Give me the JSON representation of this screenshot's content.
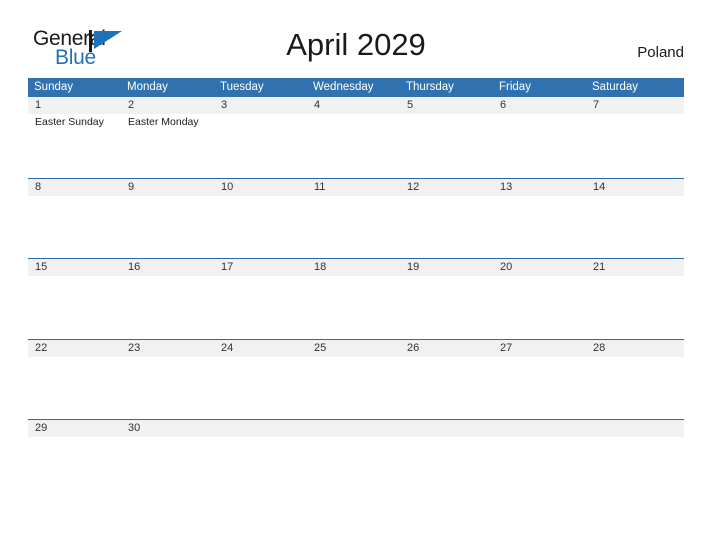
{
  "brand": {
    "word_one": "General",
    "word_two": "Blue",
    "mark_icon": "triangle-flag-icon",
    "accent_color": "#2272b8"
  },
  "header": {
    "title": "April 2029",
    "country": "Poland"
  },
  "theme": {
    "header_blue": "#3071b0",
    "row_divider_blue": "#2e6da4",
    "date_band_gray": "#f1f1f1",
    "text_dark": "#1a1a1a"
  },
  "calendar": {
    "weekdays": [
      "Sunday",
      "Monday",
      "Tuesday",
      "Wednesday",
      "Thursday",
      "Friday",
      "Saturday"
    ],
    "weeks": [
      {
        "days": [
          {
            "date": "1",
            "events": [
              "Easter Sunday"
            ]
          },
          {
            "date": "2",
            "events": [
              "Easter Monday"
            ]
          },
          {
            "date": "3",
            "events": []
          },
          {
            "date": "4",
            "events": []
          },
          {
            "date": "5",
            "events": []
          },
          {
            "date": "6",
            "events": []
          },
          {
            "date": "7",
            "events": []
          }
        ]
      },
      {
        "days": [
          {
            "date": "8",
            "events": []
          },
          {
            "date": "9",
            "events": []
          },
          {
            "date": "10",
            "events": []
          },
          {
            "date": "11",
            "events": []
          },
          {
            "date": "12",
            "events": []
          },
          {
            "date": "13",
            "events": []
          },
          {
            "date": "14",
            "events": []
          }
        ]
      },
      {
        "days": [
          {
            "date": "15",
            "events": []
          },
          {
            "date": "16",
            "events": []
          },
          {
            "date": "17",
            "events": []
          },
          {
            "date": "18",
            "events": []
          },
          {
            "date": "19",
            "events": []
          },
          {
            "date": "20",
            "events": []
          },
          {
            "date": "21",
            "events": []
          }
        ]
      },
      {
        "days": [
          {
            "date": "22",
            "events": []
          },
          {
            "date": "23",
            "events": []
          },
          {
            "date": "24",
            "events": []
          },
          {
            "date": "25",
            "events": []
          },
          {
            "date": "26",
            "events": []
          },
          {
            "date": "27",
            "events": []
          },
          {
            "date": "28",
            "events": []
          }
        ]
      },
      {
        "days": [
          {
            "date": "29",
            "events": []
          },
          {
            "date": "30",
            "events": []
          },
          {
            "date": "",
            "events": []
          },
          {
            "date": "",
            "events": []
          },
          {
            "date": "",
            "events": []
          },
          {
            "date": "",
            "events": []
          },
          {
            "date": "",
            "events": []
          }
        ]
      }
    ]
  }
}
